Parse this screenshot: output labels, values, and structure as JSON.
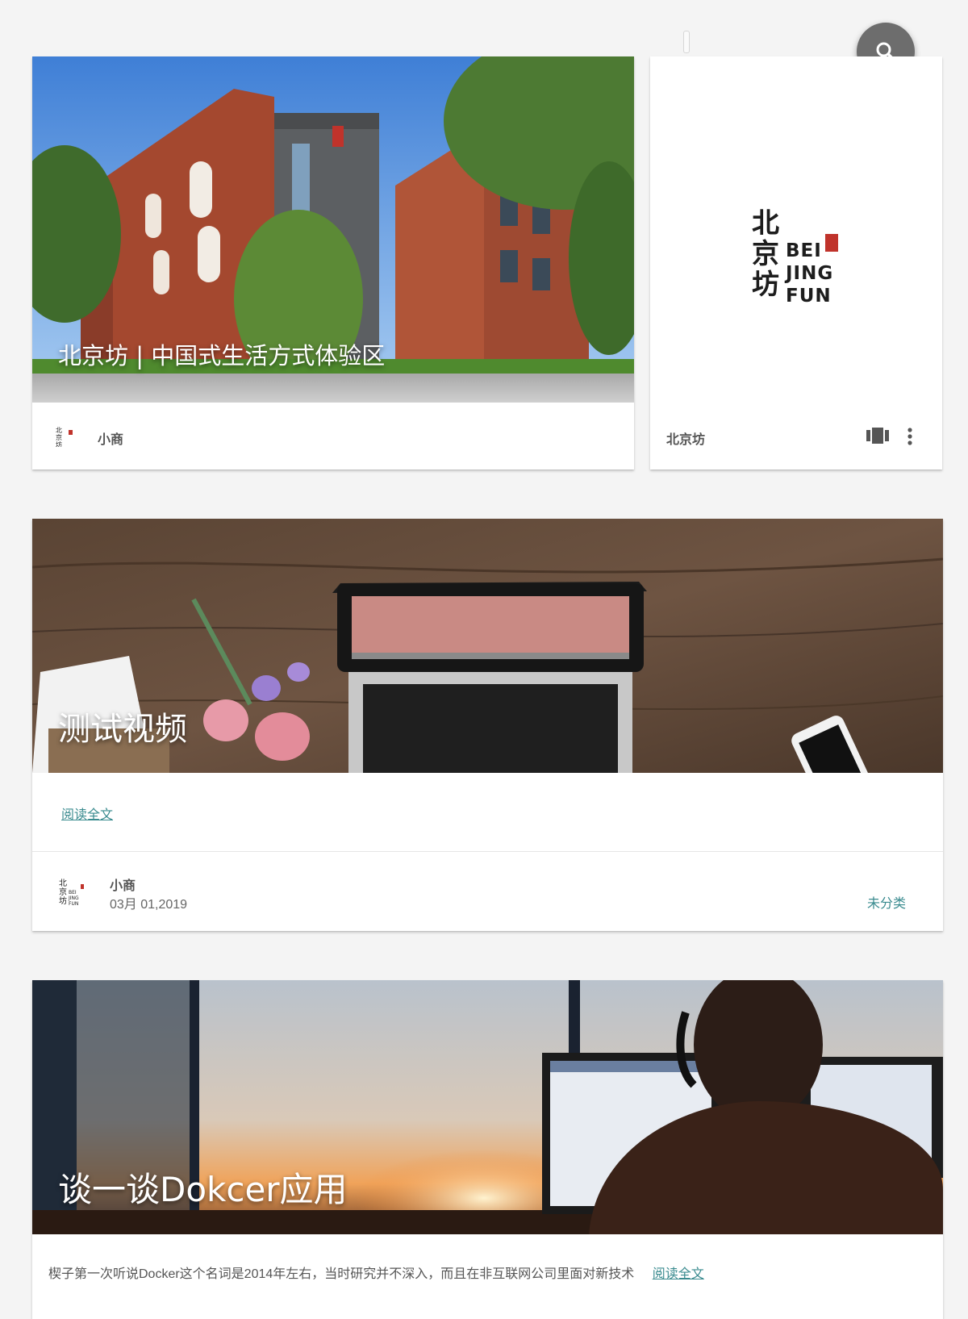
{
  "search_icon": "search-icon",
  "card1": {
    "title": "北京坊 | 中国式生活方式体验区",
    "author": "小商",
    "building_sign": "北京坊",
    "building_sign_en": "BEIJINGFUN"
  },
  "card2": {
    "logo_cn": [
      "北",
      "京",
      "坊"
    ],
    "logo_en": [
      "BEI",
      "JING",
      "FUN"
    ],
    "name": "北京坊",
    "icons": [
      "view-carousel-icon",
      "more-vert-icon"
    ]
  },
  "card3": {
    "title": "测试视频",
    "read_more": "阅读全文",
    "author": "小商",
    "date": "03月 01,2019",
    "category": "未分类"
  },
  "card4": {
    "title": "谈一谈Dokcer应用",
    "excerpt": "楔子第一次听说Docker这个名词是2014年左右，当时研究并不深入，而且在非互联网公司里面对新技术",
    "read_more": "阅读全文"
  },
  "colors": {
    "accent": "#3a8b8f",
    "fab": "#6d6d6d",
    "seal_red": "#c0332b"
  }
}
